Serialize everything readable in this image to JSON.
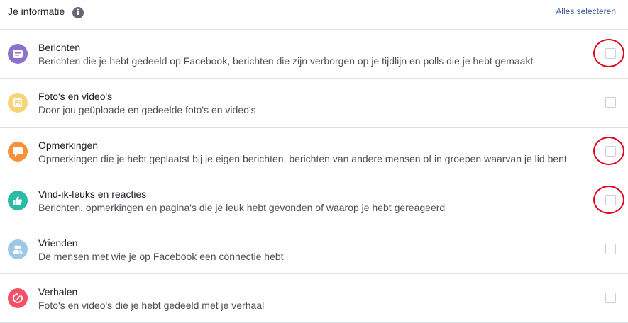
{
  "header": {
    "title": "Je informatie",
    "info_icon": "info-icon",
    "select_all_label": "Alles selecteren"
  },
  "items": [
    {
      "id": "posts",
      "name": "Berichten",
      "description": "Berichten die je hebt gedeeld op Facebook, berichten die zijn verborgen op je tijdlijn en polls die je hebt gemaakt",
      "icon": "posts-icon",
      "icon_color": "#8c72cb",
      "checked": false,
      "highlighted": true
    },
    {
      "id": "photos",
      "name": "Foto's en video's",
      "description": "Door jou geüploade en gedeelde foto's en video's",
      "icon": "photos-icon",
      "icon_color": "#f7d37a",
      "checked": false,
      "highlighted": false
    },
    {
      "id": "comments",
      "name": "Opmerkingen",
      "description": "Opmerkingen die je hebt geplaatst bij je eigen berichten, berichten van andere mensen of in groepen waarvan je lid bent",
      "icon": "comment-icon",
      "icon_color": "#f7923b",
      "checked": false,
      "highlighted": true
    },
    {
      "id": "likes",
      "name": "Vind-ik-leuks en reacties",
      "description": "Berichten, opmerkingen en pagina's die je leuk hebt gevonden of waarop je hebt gereageerd",
      "icon": "like-icon",
      "icon_color": "#2abba7",
      "checked": false,
      "highlighted": true
    },
    {
      "id": "friends",
      "name": "Vrienden",
      "description": "De mensen met wie je op Facebook een connectie hebt",
      "icon": "friends-icon",
      "icon_color": "#9cc8e6",
      "checked": false,
      "highlighted": false
    },
    {
      "id": "stories",
      "name": "Verhalen",
      "description": "Foto's en video's die je hebt gedeeld met je verhaal",
      "icon": "stories-icon",
      "icon_color": "#f25268",
      "checked": false,
      "highlighted": false
    }
  ],
  "colors": {
    "highlight_circle": "#e3001b",
    "link": "#385898",
    "divider": "#dddfe2"
  }
}
